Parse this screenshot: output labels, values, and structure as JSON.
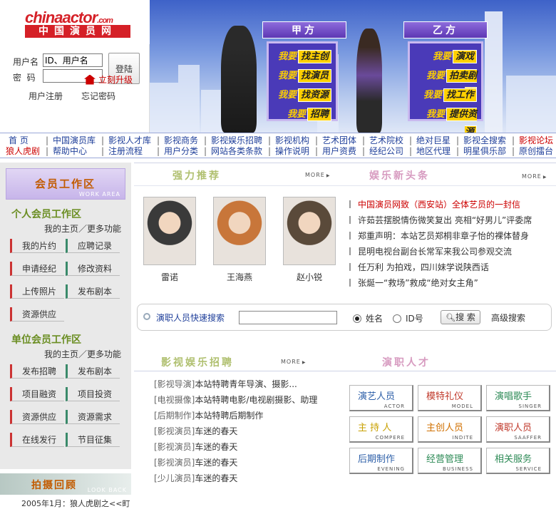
{
  "header": {
    "logo_text": "chinaactor",
    "logo_suffix": ".com",
    "logo_cn": "中国演员网",
    "login": {
      "username_label": "用户名",
      "password_label": "密  码",
      "username_value": "ID、用户名",
      "password_value": "",
      "submit_label": "登陆",
      "register_label": "用户注册",
      "forgot_label": "忘记密码",
      "upgrade_label": "立刻升级"
    },
    "party_a": {
      "title": "甲方",
      "items": [
        {
          "pre": "我要",
          "key": "找主创"
        },
        {
          "pre": "我要",
          "key": "找演员"
        },
        {
          "pre": "我要",
          "key": "找资源"
        },
        {
          "pre": "我要",
          "key": "招聘"
        }
      ]
    },
    "party_b": {
      "title": "乙方",
      "items": [
        {
          "pre": "我要",
          "key": "演戏"
        },
        {
          "pre": "我要",
          "key": "拍卖剧本"
        },
        {
          "pre": "我要",
          "key": "找工作"
        },
        {
          "pre": "我要",
          "key": "提供资源"
        }
      ]
    }
  },
  "nav": {
    "row1": [
      "首  页",
      "中国演员库",
      "影视人才库",
      "影视商务",
      "影视娱乐招聘",
      "影视机构",
      "艺术团体",
      "艺术院校",
      "绝对巨星",
      "影视全搜索",
      "影视论坛"
    ],
    "row2": [
      "狼人虎剧",
      "帮助中心",
      "注册流程",
      "用户分类",
      "网站各类条款",
      "操作说明",
      "用户资费",
      "经纪公司",
      "地区代理",
      "明星俱乐部",
      "原创擂台"
    ],
    "separator": "|"
  },
  "work_area": {
    "title": "会员工作区",
    "subtitle": "WORK AREA",
    "personal": {
      "heading": "个人会员工作区",
      "sub": "我的主页／更多功能",
      "buttons": [
        "我的片约",
        "应聘记录",
        "申请经纪",
        "修改资料",
        "上传照片",
        "发布剧本",
        "资源供应"
      ]
    },
    "unit": {
      "heading": "单位会员工作区",
      "sub": "我的主页／更多功能",
      "buttons": [
        "发布招聘",
        "发布剧本",
        "项目融资",
        "项目投资",
        "资源供应",
        "资源需求",
        "在线发行",
        "节目征集"
      ]
    }
  },
  "photo_review": {
    "title": "拍摄回顾",
    "subtitle": "LOOK BACK",
    "first_line": "2005年1月：狼人虎剧之<<町"
  },
  "recommend": {
    "title": "强力推荐",
    "more": "MORE",
    "people": [
      {
        "name": "雷诺",
        "tone": "#3a3a3a"
      },
      {
        "name": "王海燕",
        "tone": "#c8763a"
      },
      {
        "name": "赵小锐",
        "tone": "#5a4a3a"
      }
    ]
  },
  "news": {
    "title": "娱乐新头条",
    "more": "MORE",
    "items": [
      {
        "text": "中国演员网致（西安站）全体艺员的一封信",
        "color": "#cc0000"
      },
      {
        "text": "许茹芸摆脱情伤微笑复出 亮相“好男儿”评委席",
        "color": "#333333"
      },
      {
        "text": "郑重声明：本站艺员郑桐非章子怡的裸体替身",
        "color": "#333333"
      },
      {
        "text": "昆明电视台副台长常军来我公司参观交流",
        "color": "#333333"
      },
      {
        "text": "任万利 为拍戏，四川妹学说陕西话",
        "color": "#333333"
      },
      {
        "text": "张烻一“救场”救成“绝对女主角”",
        "color": "#333333"
      }
    ]
  },
  "search": {
    "label": "演职人员快速搜索",
    "input_value": "",
    "option_name": "姓名",
    "option_id": "ID号",
    "button_label": "搜 索",
    "advanced_label": "高级搜索"
  },
  "recruit": {
    "title": "影视娱乐招聘",
    "more": "MORE",
    "items": [
      {
        "tag": "[影视导演]",
        "text": "本站特聘青年导演、摄影..."
      },
      {
        "tag": "[电视摄像]",
        "text": "本站特聘电影/电视剧摄影、助理"
      },
      {
        "tag": "[后期制作]",
        "text": "本站特聘后期制作"
      },
      {
        "tag": "[影视演员]",
        "text": "车迷的春天"
      },
      {
        "tag": "[影视演员]",
        "text": "车迷的春天"
      },
      {
        "tag": "[影视演员]",
        "text": "车迷的春天"
      },
      {
        "tag": "[少儿演员]",
        "text": "车迷的春天"
      }
    ]
  },
  "talent": {
    "title": "演职人才",
    "tiles": [
      {
        "cn": "演艺人员",
        "en": "ACTOR",
        "color": "#2d5fa8"
      },
      {
        "cn": "模特礼仪",
        "en": "MODEL",
        "color": "#c0392b"
      },
      {
        "cn": "演唱歌手",
        "en": "SINGER",
        "color": "#2e8b57"
      },
      {
        "cn": "主 持 人",
        "en": "COMPERE",
        "color": "#c8a000"
      },
      {
        "cn": "主创人员",
        "en": "INDITE",
        "color": "#d07000"
      },
      {
        "cn": "演职人员",
        "en": "SAAFFER",
        "color": "#c0392b"
      },
      {
        "cn": "后期制作",
        "en": "EVENING",
        "color": "#2d5fa8"
      },
      {
        "cn": "经营管理",
        "en": "BUSINESS",
        "color": "#2e8b57"
      },
      {
        "cn": "相关服务",
        "en": "SERVICE",
        "color": "#2e8b57"
      }
    ]
  },
  "colors": {
    "brand_red": "#d52027",
    "nav_blue": "#1f3f9a",
    "banner_blue": "#3e62c8",
    "panel_purple": "#4a3ab8"
  }
}
